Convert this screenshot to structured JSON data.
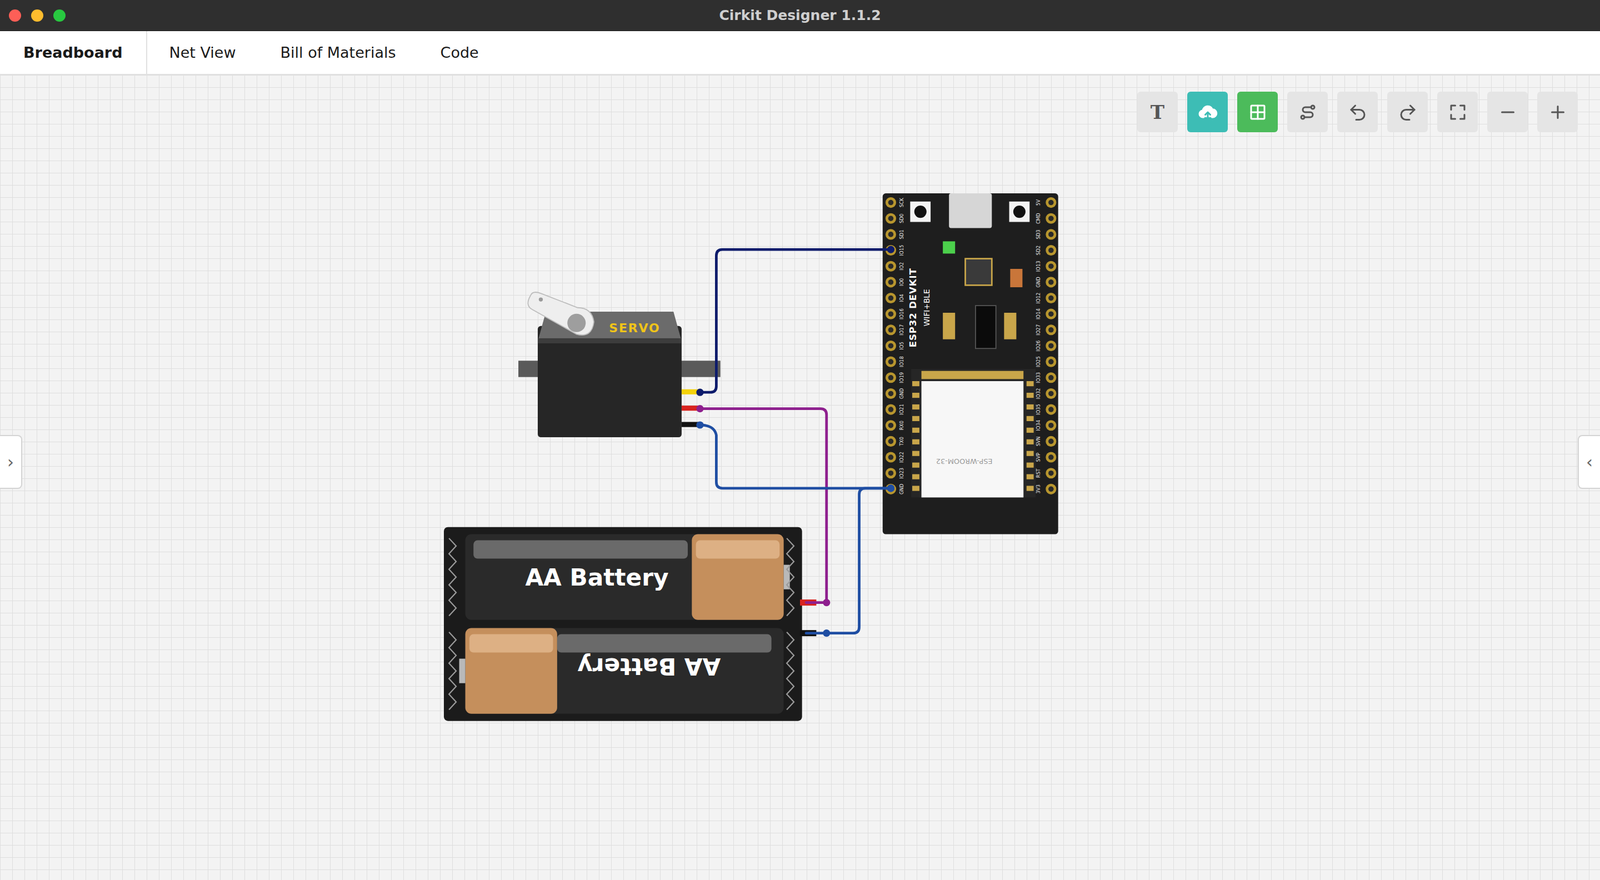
{
  "window": {
    "title": "Cirkit Designer 1.1.2",
    "traffic_lights": [
      {
        "color": "#fe5f57"
      },
      {
        "color": "#febc2e"
      },
      {
        "color": "#28c840"
      }
    ]
  },
  "tabs": [
    {
      "label": "Breadboard",
      "selected": true
    },
    {
      "label": "Net View",
      "selected": false
    },
    {
      "label": "Bill of Materials",
      "selected": false
    },
    {
      "label": "Code",
      "selected": false
    }
  ],
  "toolbar": [
    {
      "label": "T",
      "active": false,
      "color": "#e5e5e5"
    },
    {
      "active": true,
      "color": "#3dbdb5"
    },
    {
      "active": true,
      "color": "#4cbb5b"
    },
    {
      "active": false,
      "color": "#e5e5e5"
    },
    {
      "active": false,
      "color": "#e5e5e5"
    },
    {
      "active": false,
      "color": "#e5e5e5"
    },
    {
      "active": false,
      "color": "#e5e5e5"
    },
    {
      "active": false,
      "color": "#e5e5e5"
    },
    {
      "active": false,
      "color": "#e5e5e5"
    }
  ],
  "side_toggles": [
    {
      "glyph": "›"
    },
    {
      "glyph": "‹"
    }
  ],
  "canvas": {
    "esp32": {
      "title": "ESP32 DEVKIT",
      "subtitle": "WIFI+BLE",
      "module": "ESP-WROOM-32",
      "pins_left": [
        "SCK",
        "SD0",
        "SD1",
        "IO15",
        "IO2",
        "IO0",
        "IO4",
        "IO16",
        "IO17",
        "IO5",
        "IO18",
        "IO19",
        "GND",
        "IO21",
        "RX0",
        "TX0",
        "IO22",
        "IO23",
        "GND"
      ],
      "pins_right": [
        "5V",
        "CMD",
        "SD3",
        "SD2",
        "IO13",
        "GND",
        "IO12",
        "IO14",
        "IO27",
        "IO26",
        "IO25",
        "IO33",
        "IO32",
        "IO35",
        "IO34",
        "SVN",
        "SVP",
        "RST",
        "3V3"
      ]
    },
    "servo": {
      "label": "SERVO"
    },
    "battery": {
      "cells": [
        {
          "label": "AA Battery",
          "flipped": false
        },
        {
          "label": "AA Battery",
          "flipped": true
        }
      ]
    },
    "wires": [
      {
        "color": "#0d1b6b"
      },
      {
        "color": "#8e1f8e"
      },
      {
        "color": "#1f4ea3"
      },
      {
        "color": "#1f4ea3"
      }
    ]
  }
}
